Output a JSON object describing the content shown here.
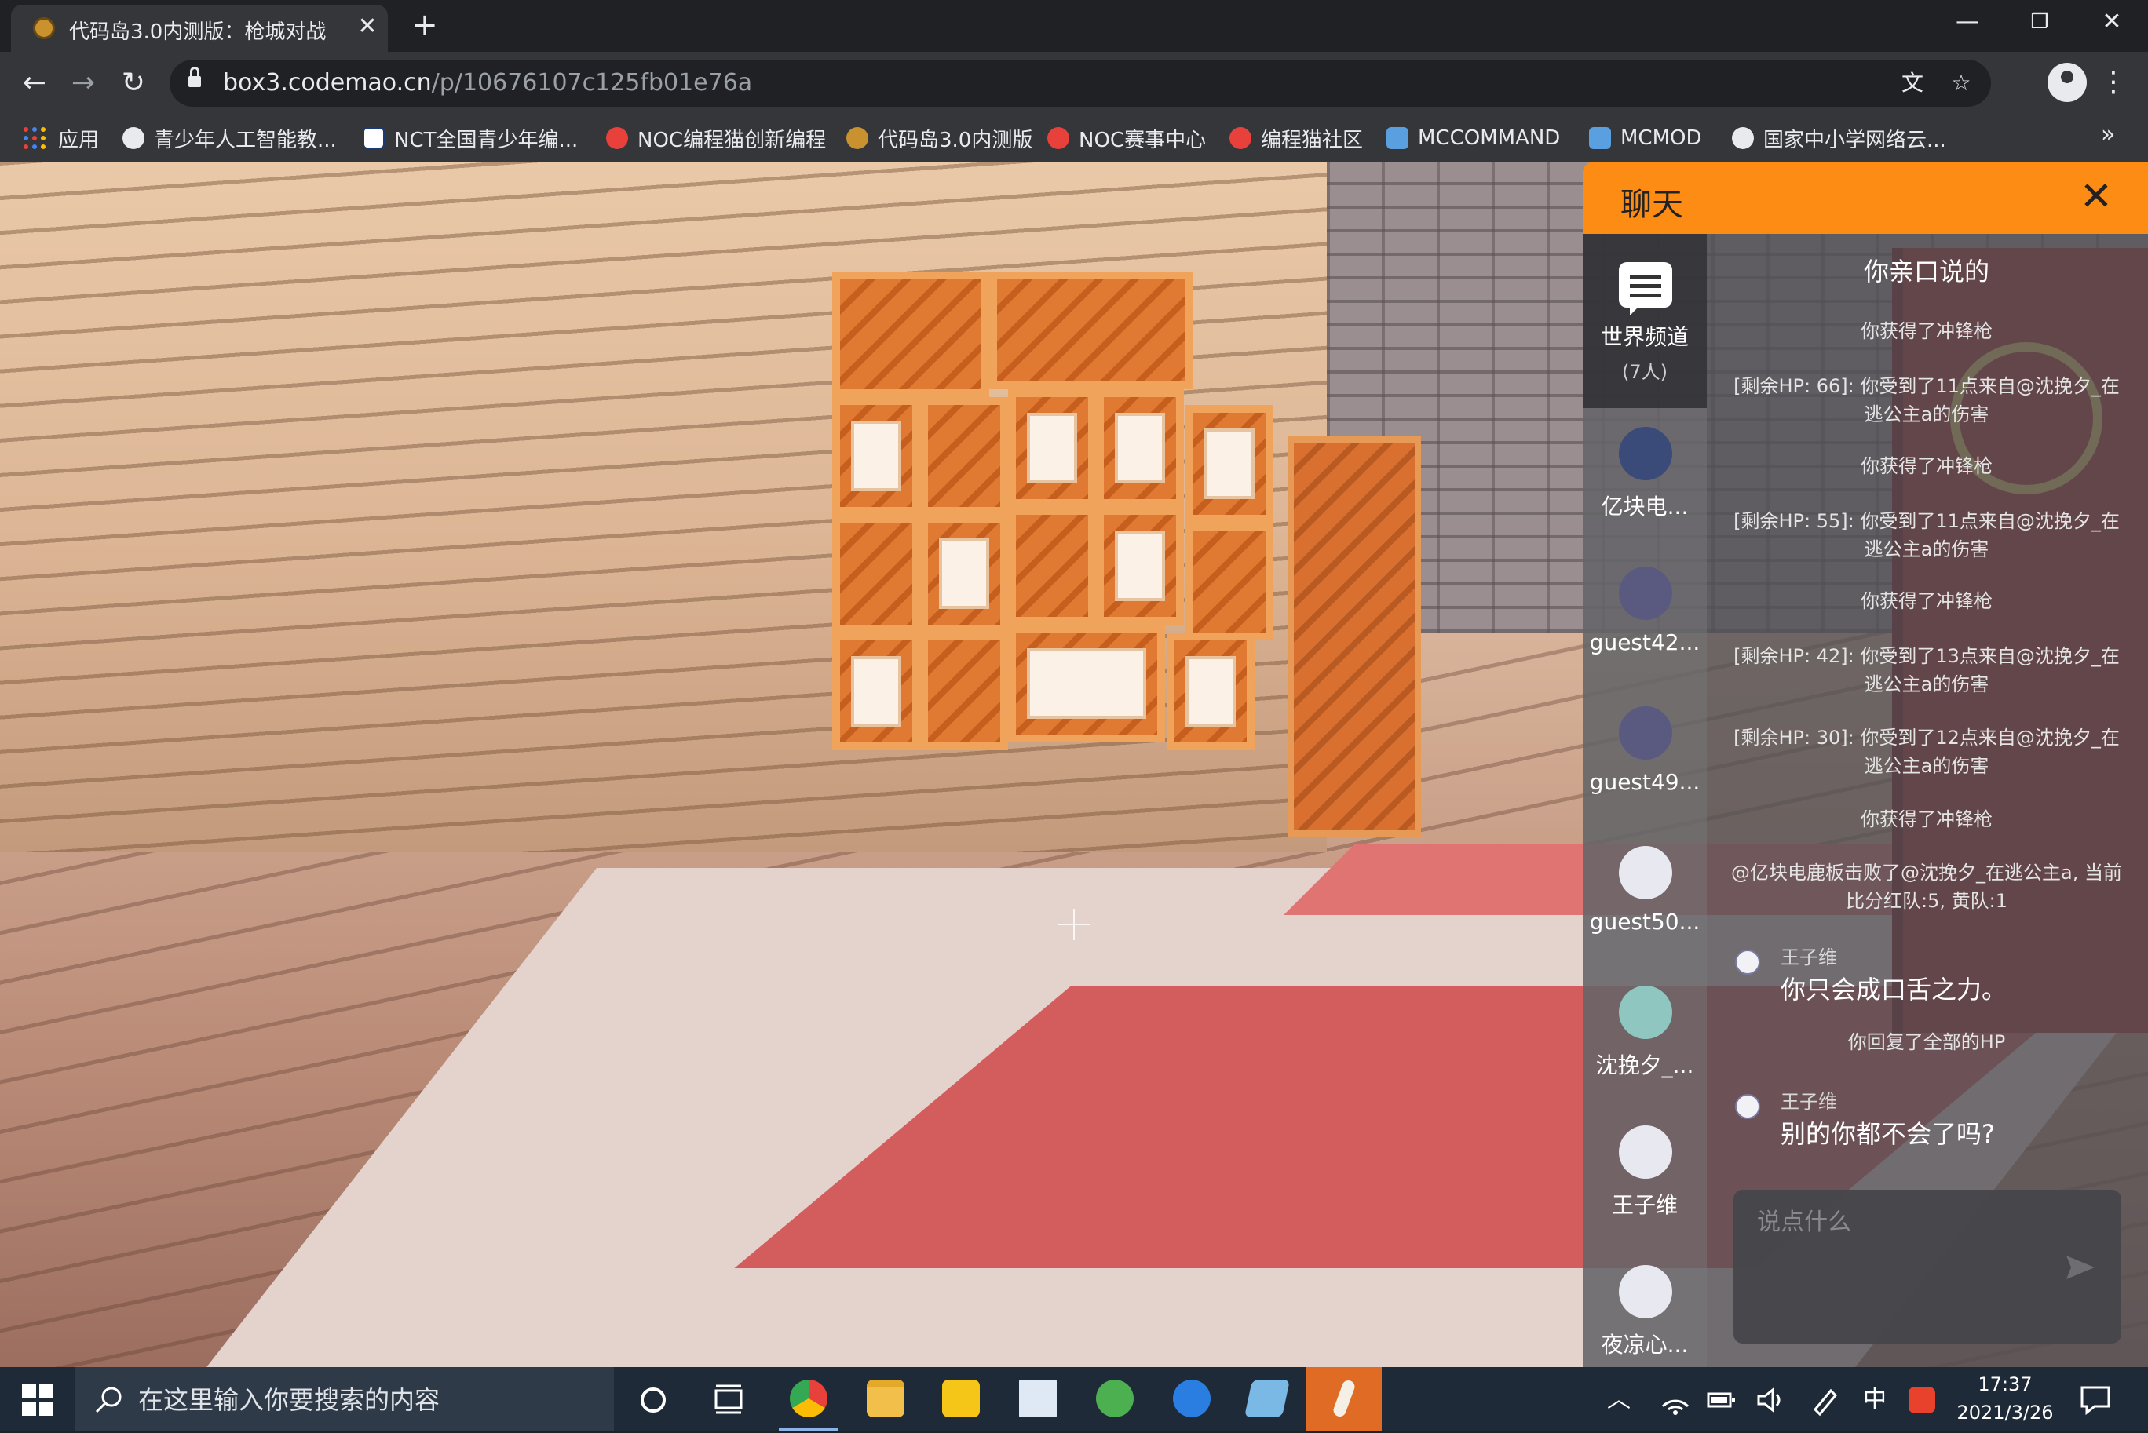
{
  "browser": {
    "tab_title": "代码岛3.0内测版：枪城对战",
    "tab_close": "✕",
    "new_tab": "+",
    "window": {
      "minimize": "—",
      "restore": "❐",
      "close": "✕"
    },
    "nav": {
      "back": "←",
      "forward": "→",
      "reload": "↻"
    },
    "url_host": "box3.codemao.cn",
    "url_path": "/p/10676107c125fb01e76a",
    "translate_icon": "文",
    "star_icon": "☆",
    "menu_icon": "⋮"
  },
  "bookmarks": {
    "items": [
      {
        "label": "应用",
        "icon": "apps-grid-icon"
      },
      {
        "label": "青少年人工智能教...",
        "icon": "globe-icon",
        "color": "#e8eaed"
      },
      {
        "label": "NCT全国青少年编...",
        "icon": "nct-icon",
        "color": "#ffffff"
      },
      {
        "label": "NOC编程猫创新编程",
        "icon": "codemao-icon",
        "color": "#e8413c"
      },
      {
        "label": "代码岛3.0内测版",
        "icon": "box3-icon",
        "color": "#c9922f"
      },
      {
        "label": "NOC赛事中心",
        "icon": "codemao-icon",
        "color": "#e8413c"
      },
      {
        "label": "编程猫社区",
        "icon": "codemao-icon",
        "color": "#e8413c"
      },
      {
        "label": "MCCOMMAND",
        "icon": "mc-icon",
        "color": "#5aa0e0"
      },
      {
        "label": "MCMOD",
        "icon": "mc-icon",
        "color": "#5aa0e0"
      },
      {
        "label": "国家中小学网络云...",
        "icon": "globe-icon",
        "color": "#e8eaed"
      }
    ],
    "more": "»"
  },
  "chat": {
    "title": "聊天",
    "close": "✕",
    "header_color": "#fd8c15",
    "channels": [
      {
        "label": "世界频道",
        "count": "(7人)",
        "icon": "chat-bubble-icon",
        "active": true
      },
      {
        "label": "亿块电...",
        "icon": "avatar-icon",
        "color": "#3a4b7a"
      },
      {
        "label": "guest42...",
        "icon": "avatar-icon",
        "color": "#5a5a80"
      },
      {
        "label": "guest49...",
        "icon": "avatar-icon",
        "color": "#5a5a80"
      },
      {
        "label": "guest50...",
        "icon": "avatar-icon",
        "color": "#e8e8f0"
      },
      {
        "label": "沈挽夕_...",
        "icon": "avatar-icon",
        "color": "#8fc7c0"
      },
      {
        "label": "王子维",
        "icon": "avatar-icon",
        "color": "#e8e8f0"
      },
      {
        "label": "夜凉心...",
        "icon": "avatar-icon",
        "color": "#e8e8f0"
      }
    ],
    "channel_heading": "你亲口说的",
    "messages": [
      {
        "type": "system",
        "text": "你获得了冲锋枪"
      },
      {
        "type": "system",
        "text": "[剩余HP: 66]: 你受到了11点来自@沈挽夕_在逃公主a的伤害"
      },
      {
        "type": "system",
        "text": "你获得了冲锋枪"
      },
      {
        "type": "system",
        "text": "[剩余HP: 55]: 你受到了11点来自@沈挽夕_在逃公主a的伤害"
      },
      {
        "type": "system",
        "text": "你获得了冲锋枪"
      },
      {
        "type": "system",
        "text": "[剩余HP: 42]: 你受到了13点来自@沈挽夕_在逃公主a的伤害"
      },
      {
        "type": "system",
        "text": "[剩余HP: 30]: 你受到了12点来自@沈挽夕_在逃公主a的伤害"
      },
      {
        "type": "system",
        "text": "你获得了冲锋枪"
      },
      {
        "type": "system",
        "text": "@亿块电鹿板击败了@沈挽夕_在逃公主a, 当前比分红队:5, 黄队:1"
      },
      {
        "type": "user",
        "name": "王子维",
        "text": "你只会成口舌之力。"
      },
      {
        "type": "system",
        "text": "你回复了全部的HP"
      },
      {
        "type": "user",
        "name": "王子维",
        "text": "别的你都不会了吗?"
      }
    ],
    "input_placeholder": "说点什么"
  },
  "taskbar": {
    "search_placeholder": "在这里输入你要搜索的内容",
    "apps": [
      {
        "name": "cortana-icon"
      },
      {
        "name": "task-view-icon"
      },
      {
        "name": "chrome-icon",
        "color": "#e8413c",
        "active": true
      },
      {
        "name": "file-explorer-icon",
        "color": "#f2c04a"
      },
      {
        "name": "photos-icon",
        "color": "#f5c518"
      },
      {
        "name": "notepad-icon",
        "color": "#dfe9f5"
      },
      {
        "name": "globe-app-icon",
        "color": "#4caf50"
      },
      {
        "name": "sogou-icon",
        "color": "#2a7de1"
      },
      {
        "name": "paint-icon",
        "color": "#7ab8e6"
      },
      {
        "name": "pen-app-icon",
        "color": "#e06b24"
      }
    ],
    "tray": {
      "up_arrow": "︿",
      "ime": "中",
      "time": "17:37",
      "date": "2021/3/26"
    }
  }
}
